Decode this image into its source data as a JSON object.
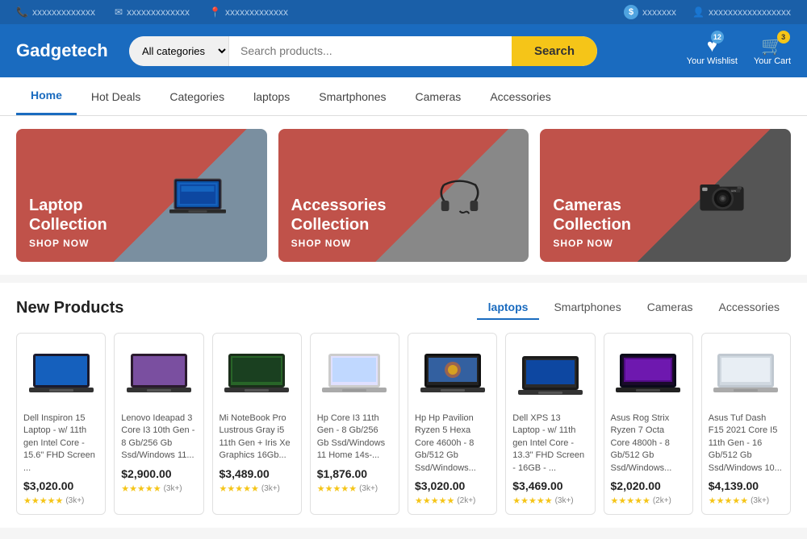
{
  "topbar": {
    "phone": "xxxxxxxxxxxxx",
    "email": "xxxxxxxxxxxxx",
    "location": "xxxxxxxxxxxxx",
    "dollars_icon": "$",
    "dollars_label": "xxxxxxx",
    "user_label": "xxxxxxxxxxxxxxxxx"
  },
  "header": {
    "logo": "Gadgetech",
    "category_default": "All categories",
    "search_placeholder": "Search products...",
    "search_label": "Search",
    "wishlist_label": "Your Wishlist",
    "wishlist_count": "12",
    "cart_label": "Your Cart",
    "cart_count": "3"
  },
  "nav": {
    "items": [
      {
        "label": "Home",
        "active": true
      },
      {
        "label": "Hot Deals",
        "active": false
      },
      {
        "label": "Categories",
        "active": false
      },
      {
        "label": "laptops",
        "active": false
      },
      {
        "label": "Smartphones",
        "active": false
      },
      {
        "label": "Cameras",
        "active": false
      },
      {
        "label": "Accessories",
        "active": false
      }
    ]
  },
  "banners": [
    {
      "title": "Laptop\nCollection",
      "shop": "SHOP NOW",
      "type": "laptop"
    },
    {
      "title": "Accessories\nCollection",
      "shop": "SHOP NOW",
      "type": "accessories"
    },
    {
      "title": "Cameras\nCollection",
      "shop": "SHOP NOW",
      "type": "cameras"
    }
  ],
  "products": {
    "section_title": "New Products",
    "tabs": [
      {
        "label": "laptops",
        "active": true
      },
      {
        "label": "Smartphones",
        "active": false
      },
      {
        "label": "Cameras",
        "active": false
      },
      {
        "label": "Accessories",
        "active": false
      }
    ],
    "items": [
      {
        "desc": "Dell Inspiron 15 Laptop - w/ 11th gen Intel Core - 15.6\" FHD Screen ...",
        "price": "$3,020.00",
        "stars": "★★★★★",
        "reviews": "(3k+)",
        "type": "laptop1"
      },
      {
        "desc": "Lenovo Ideapad 3 Core I3 10th Gen - 8 Gb/256 Gb Ssd/Windows 11...",
        "price": "$2,900.00",
        "stars": "★★★★★",
        "reviews": "(3k+)",
        "type": "laptop2"
      },
      {
        "desc": "Mi NoteBook Pro Lustrous Gray i5 11th Gen + Iris Xe Graphics 16Gb...",
        "price": "$3,489.00",
        "stars": "★★★★★",
        "reviews": "(3k+)",
        "type": "laptop3"
      },
      {
        "desc": "Hp Core I3 11th Gen - 8 Gb/256 Gb Ssd/Windows 11 Home 14s-...",
        "price": "$1,876.00",
        "stars": "★★★★★",
        "reviews": "(3k+)",
        "type": "laptop4"
      },
      {
        "desc": "Hp Hp Pavilion Ryzen 5 Hexa Core 4600h - 8 Gb/512 Gb Ssd/Windows...",
        "price": "$3,020.00",
        "stars": "★★★★★",
        "reviews": "(2k+)",
        "type": "laptop5"
      },
      {
        "desc": "Dell XPS 13 Laptop - w/ 11th gen Intel Core - 13.3\" FHD Screen - 16GB - ...",
        "price": "$3,469.00",
        "stars": "★★★★★",
        "reviews": "(3k+)",
        "type": "laptop6"
      },
      {
        "desc": "Asus Rog Strix Ryzen 7 Octa Core 4800h - 8 Gb/512 Gb Ssd/Windows...",
        "price": "$2,020.00",
        "stars": "★★★★★",
        "reviews": "(2k+)",
        "type": "laptop7"
      },
      {
        "desc": "Asus Tuf Dash F15 2021 Core I5 11th Gen - 16 Gb/512 Gb Ssd/Windows 10...",
        "price": "$4,139.00",
        "stars": "★★★★★",
        "reviews": "(3k+)",
        "type": "laptop8"
      }
    ]
  }
}
